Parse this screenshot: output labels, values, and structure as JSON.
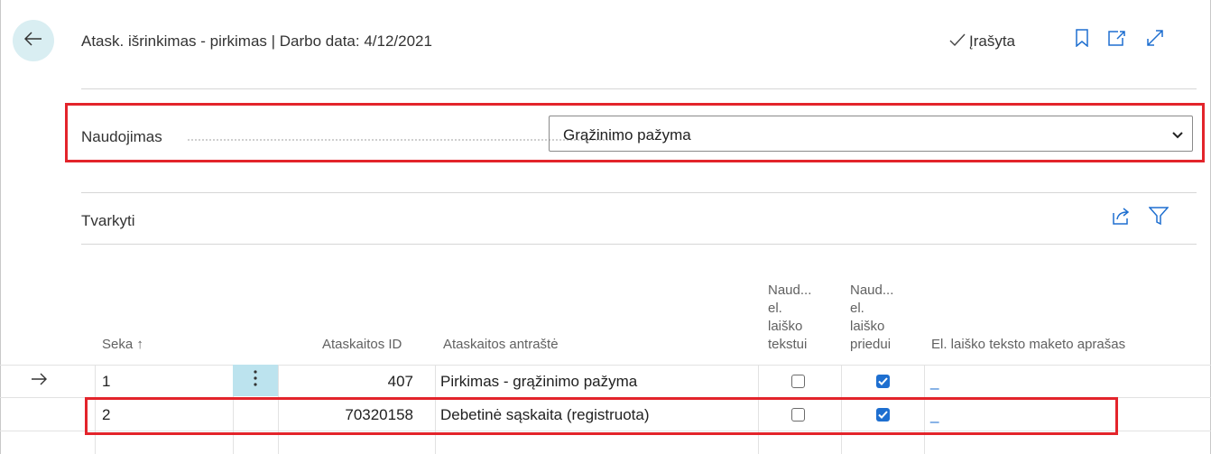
{
  "header": {
    "title": "Atask. išrinkimas - pirkimas | Darbo data: 4/12/2021",
    "saved_status": "Įrašyta",
    "icons": [
      "back-arrow-icon",
      "checkmark-icon",
      "bookmark-icon",
      "open-new-window-icon",
      "expand-icon"
    ]
  },
  "usage_field": {
    "label": "Naudojimas",
    "value": "Grąžinimo pažyma"
  },
  "section": {
    "title": "Tvarkyti",
    "icons": [
      "share-icon",
      "filter-icon"
    ]
  },
  "table": {
    "columns": {
      "seq": "Seka",
      "sort_indicator": "↑",
      "report_id": "Ataskaitos ID",
      "report_caption": "Ataskaitos antraštė",
      "use_email_body": [
        "Naud...",
        "el.",
        "laiško",
        "tekstui"
      ],
      "use_email_attachment": [
        "Naud...",
        "el.",
        "laiško",
        "priedui"
      ],
      "email_layout_desc": "El. laiško teksto maketo aprašas"
    },
    "rows": [
      {
        "seq": "1",
        "report_id": "407",
        "report_caption": "Pirkimas - grąžinimo pažyma",
        "use_email_body": false,
        "use_email_attachment": true,
        "email_layout_desc": "_"
      },
      {
        "seq": "2",
        "report_id": "70320158",
        "report_caption": "Debetinė sąskaita (registruota)",
        "use_email_body": false,
        "use_email_attachment": true,
        "email_layout_desc": "_"
      }
    ]
  },
  "colors": {
    "accent": "#1e6fd0",
    "highlight": "#e3242b",
    "selected_cell": "#bce3ee"
  }
}
